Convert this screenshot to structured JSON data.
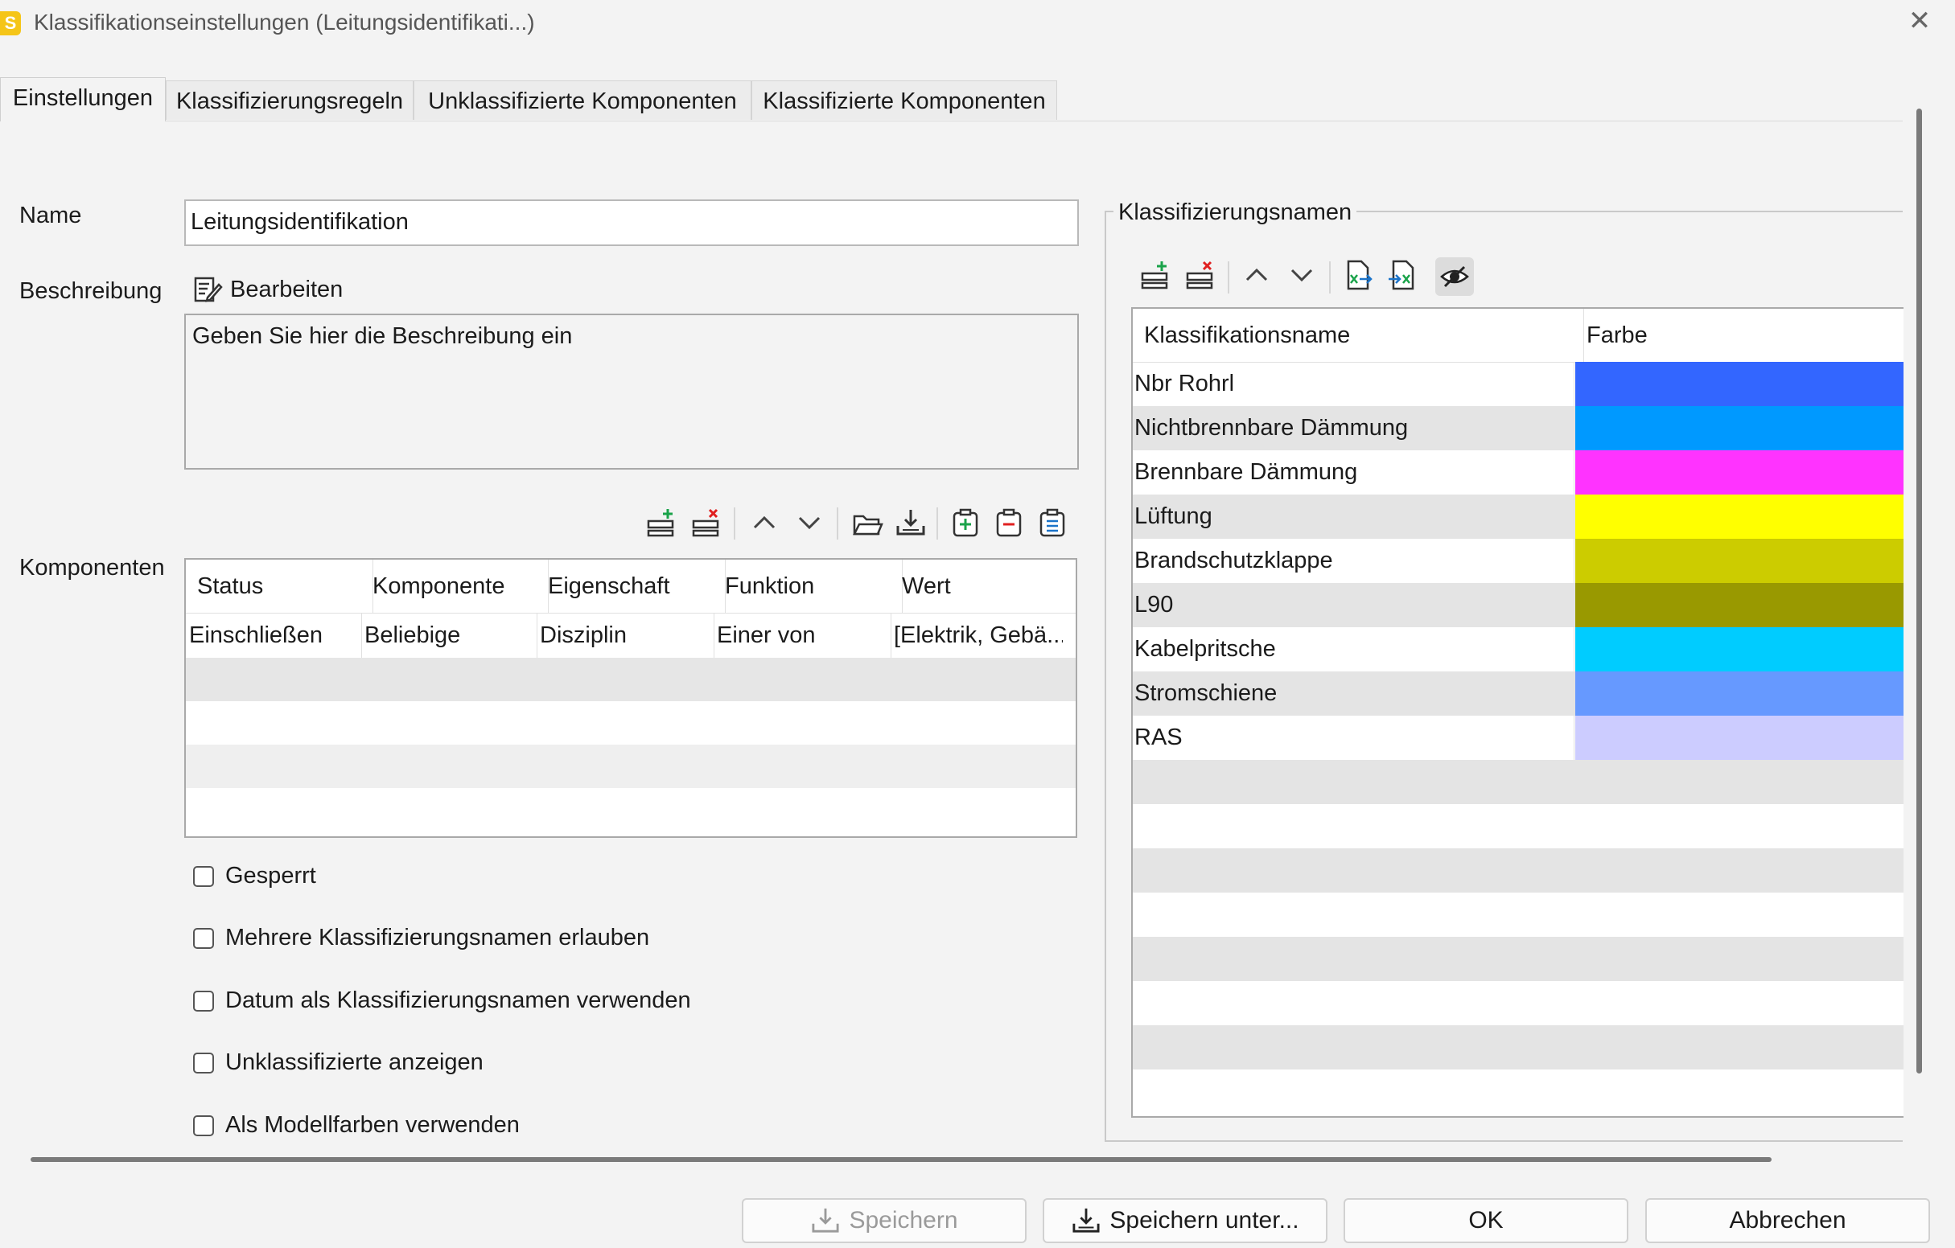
{
  "window": {
    "title": "Klassifikationseinstellungen (Leitungsidentifikati...)",
    "app_icon_letter": "S",
    "close_glyph": "✕"
  },
  "tabs": [
    {
      "label": "Einstellungen"
    },
    {
      "label": "Klassifizierungsregeln"
    },
    {
      "label": "Unklassifizierte Komponenten"
    },
    {
      "label": "Klassifizierte Komponenten"
    }
  ],
  "form": {
    "name_label": "Name",
    "name_value": "Leitungsidentifikation",
    "description_label": "Beschreibung",
    "edit_label": "Bearbeiten",
    "description_value": "Geben Sie hier die Beschreibung ein",
    "components_label": "Komponenten"
  },
  "components_table": {
    "columns": [
      "Status",
      "Komponente",
      "Eigenschaft",
      "Funktion",
      "Wert"
    ],
    "rows": [
      [
        "Einschließen",
        "Beliebige",
        "Disziplin",
        "Einer von",
        "[Elektrik, Gebä..."
      ]
    ]
  },
  "checkboxes": [
    {
      "label": "Gesperrt",
      "checked": false
    },
    {
      "label": "Mehrere Klassifizierungsnamen erlauben",
      "checked": false
    },
    {
      "label": "Datum als Klassifizierungsnamen verwenden",
      "checked": false
    },
    {
      "label": "Unklassifizierte anzeigen",
      "checked": false
    },
    {
      "label": "Als Modellfarben verwenden",
      "checked": false
    }
  ],
  "classification_names": {
    "group_title": "Klassifizierungsnamen",
    "columns": [
      "Klassifikationsname",
      "Farbe"
    ],
    "rows": [
      {
        "name": "Nbr Rohrl",
        "color": "#3366ff"
      },
      {
        "name": "Nichtbrennbare Dämmung",
        "color": "#0099ff"
      },
      {
        "name": "Brennbare Dämmung",
        "color": "#ff33ff"
      },
      {
        "name": "Lüftung",
        "color": "#ffff00"
      },
      {
        "name": "Brandschutzklappe",
        "color": "#cccc00"
      },
      {
        "name": "L90",
        "color": "#999900"
      },
      {
        "name": "Kabelpritsche",
        "color": "#00ccff"
      },
      {
        "name": "Stromschiene",
        "color": "#6699ff"
      },
      {
        "name": "RAS",
        "color": "#ccccff"
      }
    ]
  },
  "buttons": {
    "save": "Speichern",
    "save_as": "Speichern unter...",
    "ok": "OK",
    "cancel": "Abbrechen"
  }
}
